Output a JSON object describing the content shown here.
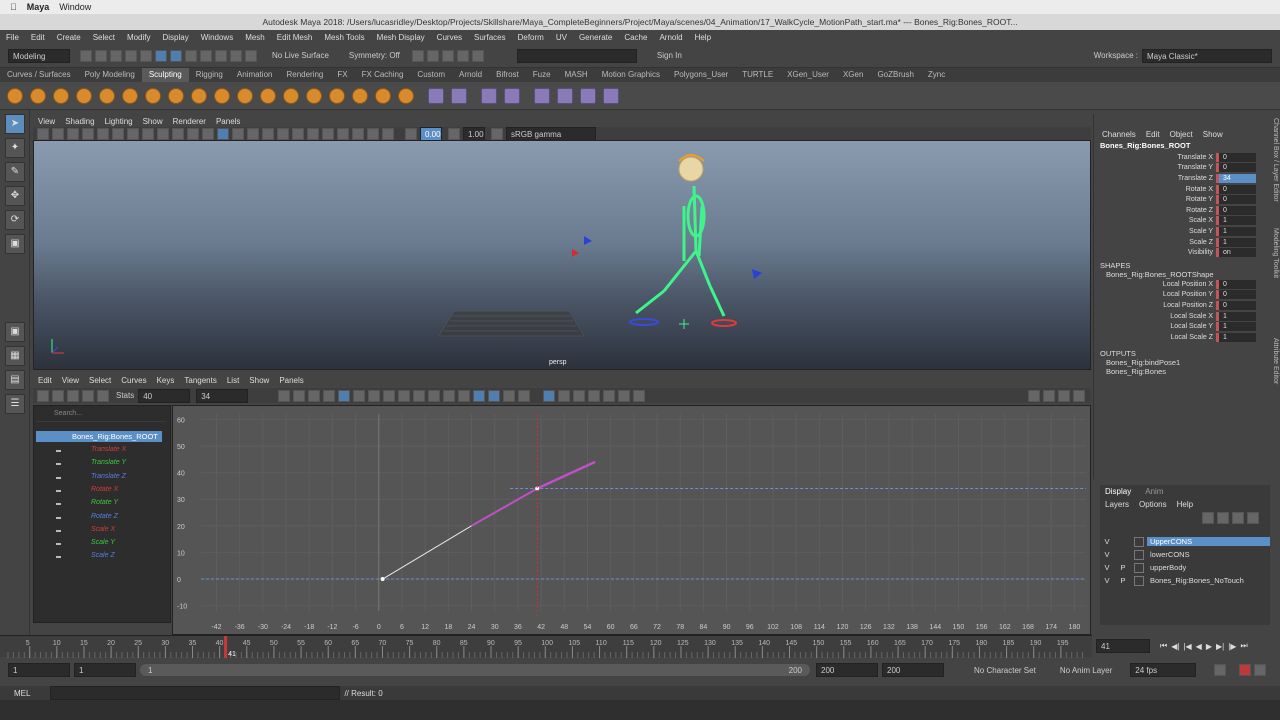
{
  "mac_menu": {
    "apple": "",
    "app": "Maya",
    "window": "Window"
  },
  "title": "Autodesk Maya 2018: /Users/lucasridley/Desktop/Projects/Skillshare/Maya_CompleteBeginners/Project/Maya/scenes/04_Animation/17_WalkCycle_MotionPath_start.ma*   ---   Bones_Rig:Bones_ROOT...",
  "main_menu": [
    "File",
    "Edit",
    "Create",
    "Select",
    "Modify",
    "Display",
    "Windows",
    "Mesh",
    "Edit Mesh",
    "Mesh Tools",
    "Mesh Display",
    "Curves",
    "Surfaces",
    "Deform",
    "UV",
    "Generate",
    "Cache",
    "Arnold",
    "Help"
  ],
  "status_line": {
    "mode": "Modeling",
    "live_surface": "No Live Surface",
    "symmetry": "Symmetry: Off",
    "signin": "Sign In",
    "workspace_label": "Workspace :",
    "workspace": "Maya Classic*"
  },
  "shelf_tabs": [
    "Curves / Surfaces",
    "Poly Modeling",
    "Sculpting",
    "Rigging",
    "Animation",
    "Rendering",
    "FX",
    "FX Caching",
    "Custom",
    "Arnold",
    "Bifrost",
    "Fuze",
    "MASH",
    "Motion Graphics",
    "Polygons_User",
    "TURTLE",
    "XGen_User",
    "XGen",
    "GoZBrush",
    "Zync"
  ],
  "active_shelf_tab": "Sculpting",
  "viewport": {
    "menu": [
      "View",
      "Shading",
      "Lighting",
      "Show",
      "Renderer",
      "Panels"
    ],
    "exposure": "0.00",
    "gamma": "1.00",
    "colorspace": "sRGB gamma",
    "camera": "persp"
  },
  "graph_editor": {
    "menu": [
      "Edit",
      "View",
      "Select",
      "Curves",
      "Keys",
      "Tangents",
      "List",
      "Show",
      "Panels"
    ],
    "stats_label": "Stats",
    "stats_frame": "40",
    "stats_value": "34",
    "search_placeholder": "Search...",
    "root": "Bones_Rig:Bones_ROOT",
    "attributes": [
      {
        "name": "Translate X",
        "color": "#d23c3c"
      },
      {
        "name": "Translate Y",
        "color": "#3cc83c"
      },
      {
        "name": "Translate Z",
        "color": "#5a7ee0"
      },
      {
        "name": "Rotate X",
        "color": "#d23c3c"
      },
      {
        "name": "Rotate Y",
        "color": "#3cc83c"
      },
      {
        "name": "Rotate Z",
        "color": "#5a7ee0"
      },
      {
        "name": "Scale X",
        "color": "#d23c3c"
      },
      {
        "name": "Scale Y",
        "color": "#3cc83c"
      },
      {
        "name": "Scale Z",
        "color": "#5a7ee0"
      }
    ],
    "y_ticks": [
      "60",
      "50",
      "40",
      "30",
      "20",
      "10",
      "0",
      "-10"
    ],
    "x_ticks": [
      "-42",
      "-36",
      "-30",
      "-24",
      "-18",
      "-12",
      "-6",
      "0",
      "6",
      "12",
      "18",
      "24",
      "30",
      "36",
      "42",
      "48",
      "54",
      "60",
      "66",
      "72",
      "78",
      "84",
      "90",
      "96",
      "102",
      "108",
      "114",
      "120",
      "126",
      "132",
      "138",
      "144",
      "150",
      "156",
      "162",
      "168",
      "174",
      "180"
    ]
  },
  "channel_box": {
    "tabs": [
      "Channels",
      "Edit",
      "Object",
      "Show"
    ],
    "node": "Bones_Rig:Bones_ROOT",
    "channels": [
      {
        "name": "Translate X",
        "value": "0"
      },
      {
        "name": "Translate Y",
        "value": "0"
      },
      {
        "name": "Translate Z",
        "value": "34",
        "highlight": true
      },
      {
        "name": "Rotate X",
        "value": "0"
      },
      {
        "name": "Rotate Y",
        "value": "0"
      },
      {
        "name": "Rotate Z",
        "value": "0"
      },
      {
        "name": "Scale X",
        "value": "1"
      },
      {
        "name": "Scale Y",
        "value": "1"
      },
      {
        "name": "Scale Z",
        "value": "1"
      },
      {
        "name": "Visibility",
        "value": "on"
      }
    ],
    "shapes_header": "SHAPES",
    "shape_node": "Bones_Rig:Bones_ROOTShape",
    "shape_channels": [
      {
        "name": "Local Position X",
        "value": "0"
      },
      {
        "name": "Local Position Y",
        "value": "0"
      },
      {
        "name": "Local Position Z",
        "value": "0"
      },
      {
        "name": "Local Scale X",
        "value": "1"
      },
      {
        "name": "Local Scale Y",
        "value": "1"
      },
      {
        "name": "Local Scale Z",
        "value": "1"
      }
    ],
    "outputs_header": "OUTPUTS",
    "outputs": [
      "Bones_Rig:bindPose1",
      "Bones_Rig:Bones"
    ]
  },
  "right_tabs": [
    "Channel Box / Layer Editor",
    "Modeling Toolkit",
    "Attribute Editor"
  ],
  "layer_editor": {
    "tabs": [
      "Display",
      "Anim"
    ],
    "menu": [
      "Layers",
      "Options",
      "Help"
    ],
    "layers": [
      {
        "v": "V",
        "p": "",
        "name": "UpperCONS",
        "highlight": true
      },
      {
        "v": "V",
        "p": "",
        "name": "lowerCONS"
      },
      {
        "v": "V",
        "p": "P",
        "name": "upperBody"
      },
      {
        "v": "V",
        "p": "P",
        "name": "Bones_Rig:Bones_NoTouch"
      }
    ]
  },
  "time_slider": {
    "ticks": [
      "5",
      "10",
      "15",
      "20",
      "25",
      "30",
      "35",
      "40",
      "45",
      "50",
      "55",
      "60",
      "65",
      "70",
      "75",
      "80",
      "85",
      "90",
      "95",
      "100",
      "105",
      "110",
      "115",
      "120",
      "125",
      "130",
      "135",
      "140",
      "145",
      "150",
      "155",
      "160",
      "165",
      "170",
      "175",
      "180",
      "185",
      "190",
      "195"
    ],
    "current_frame_label": "41",
    "current_frame": "41"
  },
  "range_slider": {
    "start": "1",
    "playback_start": "1",
    "range_start_label": "1",
    "range_end_label": "200",
    "playback_end": "200",
    "end": "200",
    "character": "No Character Set",
    "anim_layer": "No Anim Layer",
    "fps": "24 fps"
  },
  "command_line": {
    "label": "MEL",
    "result": "// Result: 0"
  }
}
